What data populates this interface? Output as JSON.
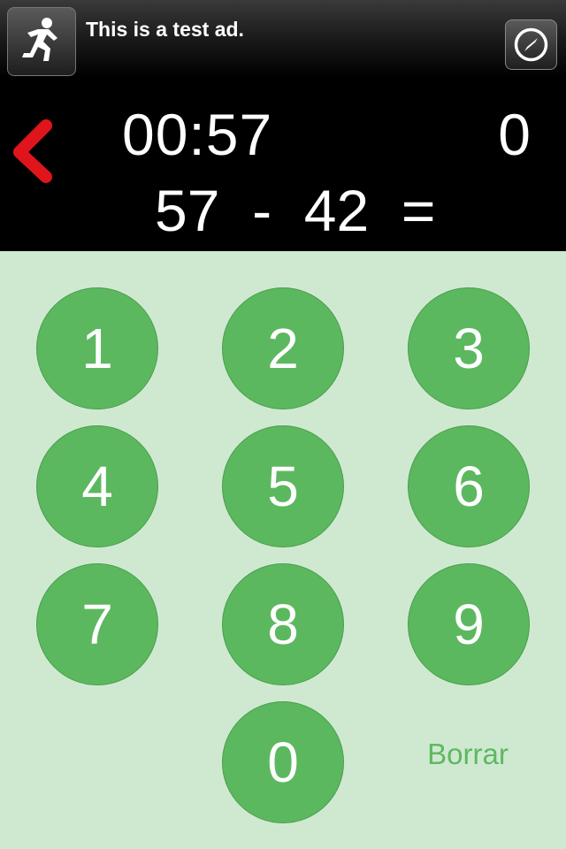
{
  "ad": {
    "text": "This is a test ad.",
    "icon": "runner-icon",
    "action_icon": "compass-icon"
  },
  "game": {
    "back_icon": "chevron-left-icon",
    "timer": "00:57",
    "score": "0",
    "equation": "57  -  42  ="
  },
  "keypad": {
    "keys": [
      "1",
      "2",
      "3",
      "4",
      "5",
      "6",
      "7",
      "8",
      "9",
      "0"
    ],
    "clear_label": "Borrar"
  },
  "colors": {
    "pad_background": "#cfe9d1",
    "key_green": "#5cb85f",
    "back_red": "#e0151b",
    "clear_text": "#5fb862"
  }
}
